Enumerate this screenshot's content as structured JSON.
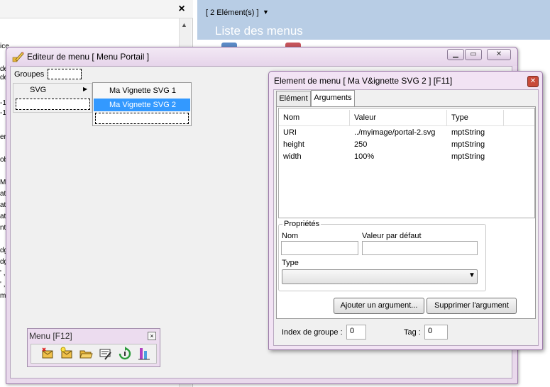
{
  "background_left": {
    "close_glyph": "×",
    "fragments": [
      "ice",
      "de",
      "de",
      "-1",
      "-1",
      "er",
      "ob",
      "M",
      "ati",
      "ati",
      "ati",
      "nt",
      "dg",
      "dg",
      "' ,",
      "' ,",
      "m"
    ]
  },
  "background_right": {
    "element_count": "[ 2 Elément(s) ]",
    "title": "Liste des menus"
  },
  "editor": {
    "title": "Editeur de menu [ Menu Portail ]",
    "minimize_glyph": "▁",
    "restore_glyph": "▭",
    "close_glyph": "✕",
    "groups_label": "Groupes",
    "group_svg_label": "SVG",
    "submenu_items": [
      "Ma Vignette SVG 1",
      "Ma Vignette SVG 2"
    ]
  },
  "toolbar": {
    "title": "Menu [F12]",
    "close_glyph": "☒",
    "icons": [
      "add-item-icon",
      "new-item-icon",
      "open-folder-icon",
      "edit-menu-icon",
      "refresh-icon",
      "properties-icon"
    ]
  },
  "dialog": {
    "title": "Element de menu [ Ma V&ignette SVG 2 ] [F11]",
    "close_glyph": "✕",
    "tabs": [
      {
        "label": "Elément",
        "selected": false
      },
      {
        "label": "Arguments",
        "selected": true
      }
    ],
    "table": {
      "headers": [
        "Nom",
        "Valeur",
        "Type"
      ],
      "rows": [
        {
          "name": "URI",
          "value": "../myimage/portal-2.svg",
          "type": "mptString"
        },
        {
          "name": "height",
          "value": "250",
          "type": "mptString"
        },
        {
          "name": "width",
          "value": "100%",
          "type": "mptString"
        }
      ]
    },
    "properties": {
      "legend": "Propriétés",
      "name_label": "Nom",
      "name_value": "",
      "default_label": "Valeur par défaut",
      "default_value": "",
      "type_label": "Type",
      "type_value": ""
    },
    "buttons": {
      "add": "Ajouter un argument...",
      "remove": "Supprimer l'argument"
    },
    "group_index_label": "Index de groupe :",
    "group_index_value": "0",
    "tag_label": "Tag :",
    "tag_value": "0"
  }
}
